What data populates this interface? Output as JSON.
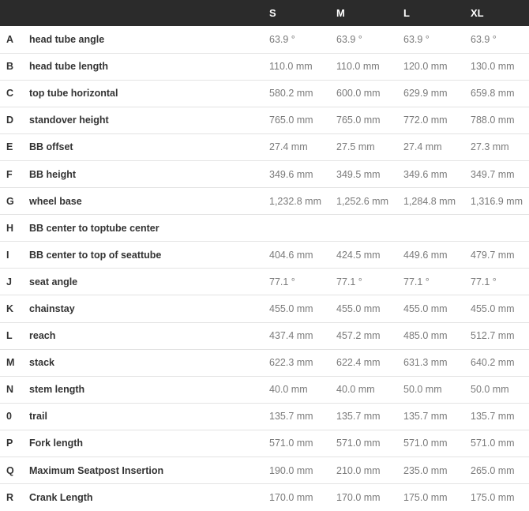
{
  "header": {
    "letter": "",
    "label": "",
    "sizes": [
      "S",
      "M",
      "L",
      "XL"
    ]
  },
  "rows": [
    {
      "letter": "A",
      "label": "head tube angle",
      "values": [
        "63.9 °",
        "63.9 °",
        "63.9 °",
        "63.9 °"
      ]
    },
    {
      "letter": "B",
      "label": "head tube length",
      "values": [
        "110.0 mm",
        "110.0 mm",
        "120.0 mm",
        "130.0 mm"
      ]
    },
    {
      "letter": "C",
      "label": "top tube horizontal",
      "values": [
        "580.2 mm",
        "600.0 mm",
        "629.9 mm",
        "659.8 mm"
      ]
    },
    {
      "letter": "D",
      "label": "standover height",
      "values": [
        "765.0 mm",
        "765.0 mm",
        "772.0 mm",
        "788.0 mm"
      ]
    },
    {
      "letter": "E",
      "label": "BB offset",
      "values": [
        "27.4 mm",
        "27.5 mm",
        "27.4 mm",
        "27.3 mm"
      ]
    },
    {
      "letter": "F",
      "label": "BB height",
      "values": [
        "349.6 mm",
        "349.5 mm",
        "349.6 mm",
        "349.7 mm"
      ]
    },
    {
      "letter": "G",
      "label": "wheel base",
      "values": [
        "1,232.8 mm",
        "1,252.6 mm",
        "1,284.8 mm",
        "1,316.9 mm"
      ]
    },
    {
      "letter": "H",
      "label": "BB center to toptube center",
      "values": [
        "",
        "",
        "",
        ""
      ]
    },
    {
      "letter": "I",
      "label": "BB center to top of seattube",
      "values": [
        "404.6 mm",
        "424.5 mm",
        "449.6 mm",
        "479.7 mm"
      ]
    },
    {
      "letter": "J",
      "label": "seat angle",
      "values": [
        "77.1 °",
        "77.1 °",
        "77.1 °",
        "77.1 °"
      ]
    },
    {
      "letter": "K",
      "label": "chainstay",
      "values": [
        "455.0 mm",
        "455.0 mm",
        "455.0 mm",
        "455.0 mm"
      ]
    },
    {
      "letter": "L",
      "label": "reach",
      "values": [
        "437.4 mm",
        "457.2 mm",
        "485.0 mm",
        "512.7 mm"
      ]
    },
    {
      "letter": "M",
      "label": "stack",
      "values": [
        "622.3 mm",
        "622.4 mm",
        "631.3 mm",
        "640.2 mm"
      ]
    },
    {
      "letter": "N",
      "label": "stem length",
      "values": [
        "40.0 mm",
        "40.0 mm",
        "50.0 mm",
        "50.0 mm"
      ]
    },
    {
      "letter": "0",
      "label": "trail",
      "values": [
        "135.7 mm",
        "135.7 mm",
        "135.7 mm",
        "135.7 mm"
      ]
    },
    {
      "letter": "P",
      "label": "Fork length",
      "values": [
        "571.0 mm",
        "571.0 mm",
        "571.0 mm",
        "571.0 mm"
      ]
    },
    {
      "letter": "Q",
      "label": "Maximum Seatpost Insertion",
      "values": [
        "190.0 mm",
        "210.0 mm",
        "235.0 mm",
        "265.0 mm"
      ]
    },
    {
      "letter": "R",
      "label": "Crank Length",
      "values": [
        "170.0 mm",
        "170.0 mm",
        "175.0 mm",
        "175.0 mm"
      ]
    }
  ]
}
